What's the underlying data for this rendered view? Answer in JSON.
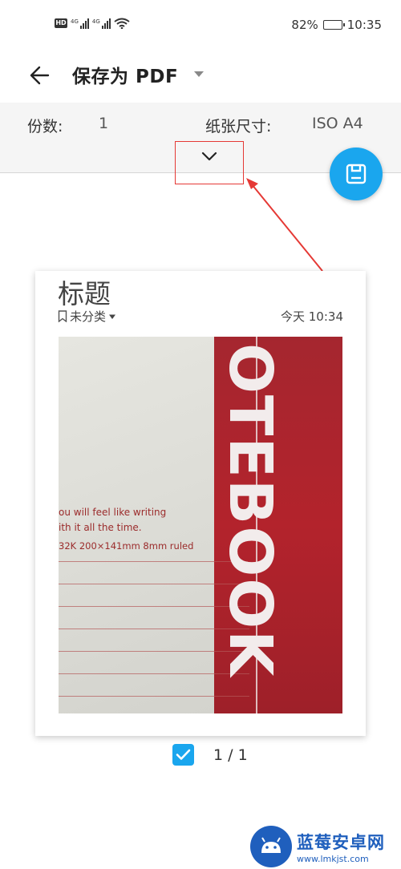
{
  "status_bar": {
    "network_badge": "HD",
    "signal_1": "4G",
    "signal_2": "4G",
    "battery": "82%",
    "battery_level": 0.82,
    "time": "10:35"
  },
  "top_bar": {
    "title": "保存为 PDF",
    "icons": [
      "back-arrow-icon",
      "dropdown-caret-icon"
    ]
  },
  "options": {
    "copies_label": "份数:",
    "copies_value": "1",
    "paper_size_label": "纸张尺寸:",
    "paper_size_value": "ISO A4",
    "expand_icon": "chevron-down-icon"
  },
  "fab": {
    "icon": "save-icon",
    "color": "#1aa6ee"
  },
  "annotation": {
    "color": "#e53935"
  },
  "preview": {
    "note_title": "标题",
    "category": "未分类",
    "time": "今天 10:34",
    "photo_text": {
      "line1": "ou will feel like writing",
      "line2": "ith it all the time.",
      "spec": "32K  200×141mm  8mm ruled",
      "brand": "OTEBOOK"
    }
  },
  "page_select": {
    "checked": true,
    "count": "1 / 1"
  },
  "watermark": {
    "name": "蓝莓安卓网",
    "url": "www.lmkjst.com"
  }
}
